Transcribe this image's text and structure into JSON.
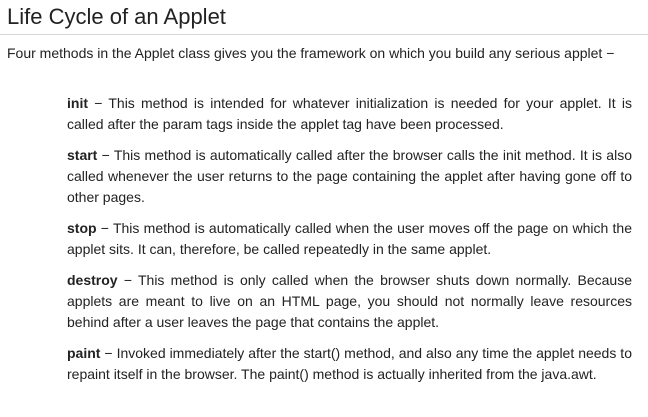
{
  "title": "Life Cycle of an Applet",
  "intro": "Four methods in the Applet class gives you the framework on which you build any serious applet −",
  "methods": [
    {
      "name": "init",
      "description": " − This method is intended for whatever initialization is needed for your applet. It is called after the param tags inside the applet tag have been processed."
    },
    {
      "name": "start",
      "description": " − This method is automatically called after the browser calls the init method. It is also called whenever the user returns to the page containing the applet after having gone off to other pages."
    },
    {
      "name": "stop",
      "description": " − This method is automatically called when the user moves off the page on which the applet sits. It can, therefore, be called repeatedly in the same applet."
    },
    {
      "name": "destroy",
      "description": " − This method is only called when the browser shuts down normally. Because applets are meant to live on an HTML page, you should not normally leave resources behind after a user leaves the page that contains the applet."
    },
    {
      "name": "paint",
      "description": " − Invoked immediately after the start() method, and also any time the applet needs to repaint itself in the browser. The paint() method is actually inherited from the java.awt."
    }
  ]
}
